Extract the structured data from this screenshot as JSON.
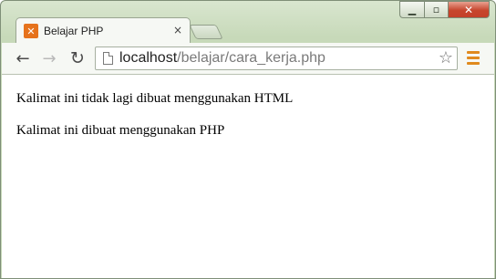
{
  "window": {
    "controls": {
      "minimize_icon": "minimize-icon",
      "maximize_icon": "maximize-icon",
      "close_icon": "close-icon"
    }
  },
  "tab": {
    "title": "Belajar PHP",
    "favicon_glyph": "✕",
    "favicon_color": "#e6731c",
    "close_glyph": "×"
  },
  "toolbar": {
    "back_glyph": "←",
    "forward_glyph": "→",
    "reload_glyph": "↻",
    "url_host": "localhost",
    "url_path": "/belajar/cara_kerja.php",
    "star_glyph": "☆",
    "menu_color": "#e08a1e"
  },
  "content": {
    "line1": "Kalimat ini tidak lagi dibuat menggunakan HTML",
    "line2": "Kalimat ini dibuat menggunakan PHP"
  }
}
